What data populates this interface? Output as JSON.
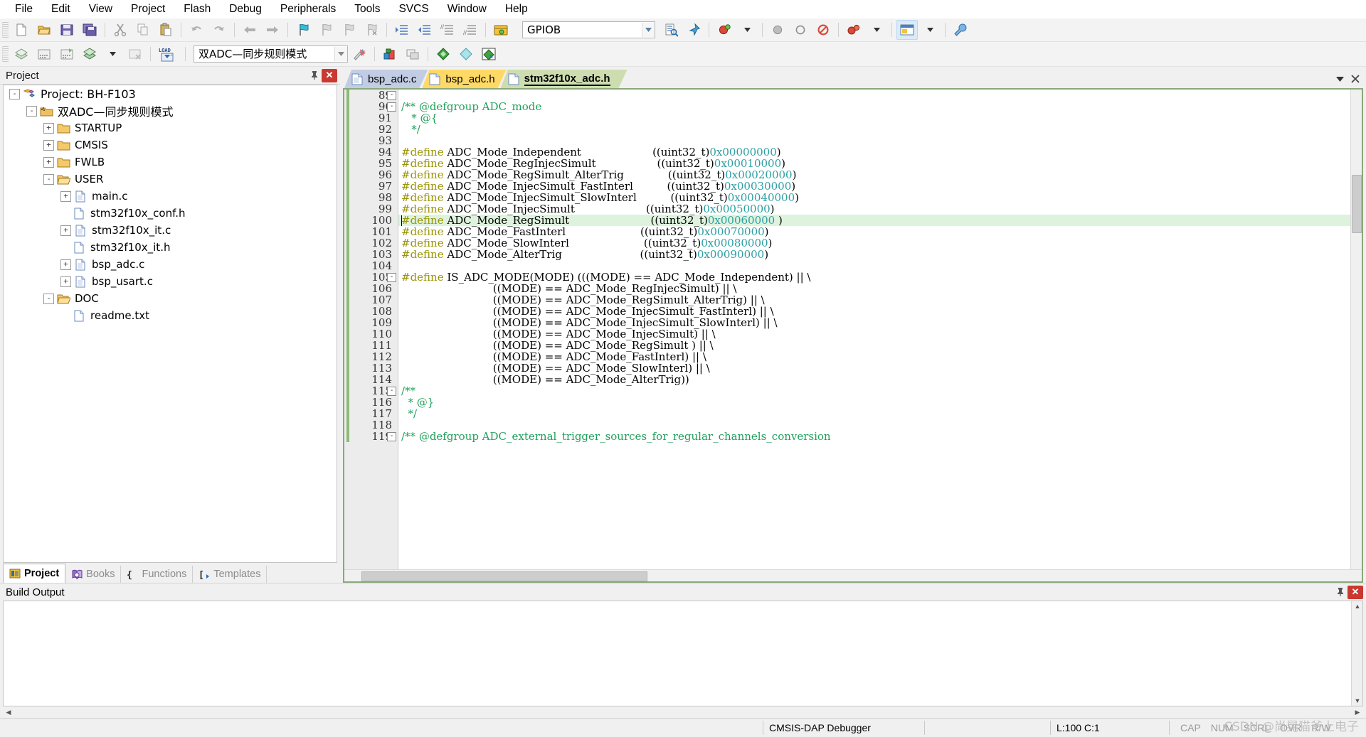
{
  "menu": {
    "items": [
      "File",
      "Edit",
      "View",
      "Project",
      "Flash",
      "Debug",
      "Peripherals",
      "Tools",
      "SVCS",
      "Window",
      "Help"
    ]
  },
  "toolbar1": {
    "icons": [
      "new-file-icon",
      "open-file-icon",
      "save-icon",
      "save-all-icon",
      "cut-icon",
      "copy-icon",
      "paste-icon",
      "undo-icon",
      "redo-icon",
      "navigate-back-icon",
      "navigate-forward-icon",
      "bookmark-toggle-icon",
      "bookmark-prev-icon",
      "bookmark-next-icon",
      "bookmark-clear-icon",
      "indent-icon",
      "outdent-icon",
      "comment-icon",
      "uncomment-icon",
      "open-debugger-icon",
      "find-icon",
      "find-dropdown-icon",
      "breakpoint-insert-icon",
      "breakpoint-disable-icon",
      "breakpoint-disable-all-icon",
      "breakpoint-kill-all-icon",
      "configure-icon",
      "wrench-icon"
    ],
    "find_value": "GPIOB"
  },
  "toolbar2": {
    "icons": [
      "translate-icon",
      "build-icon",
      "rebuild-icon",
      "batch-build-icon",
      "batch-build-dropdown-icon",
      "stop-build-icon",
      "download-icon",
      "target-options-icon",
      "manage-runtime-icon",
      "manage-multi-project-icon",
      "component-green-icon",
      "component-cyan-icon",
      "component-packs-icon"
    ],
    "target_value": "双ADC—同步规则模式"
  },
  "project": {
    "panel_title": "Project",
    "pin_icon": "pin-icon",
    "close_icon": "close-icon",
    "tree": [
      {
        "label": "Project: BH-F103",
        "depth": 0,
        "expander": "-",
        "icon": "project-icon"
      },
      {
        "label": "双ADC—同步规则模式",
        "depth": 1,
        "expander": "-",
        "icon": "target-icon"
      },
      {
        "label": "STARTUP",
        "depth": 2,
        "expander": "+",
        "icon": "folder-icon"
      },
      {
        "label": "CMSIS",
        "depth": 2,
        "expander": "+",
        "icon": "folder-icon"
      },
      {
        "label": "FWLB",
        "depth": 2,
        "expander": "+",
        "icon": "folder-icon"
      },
      {
        "label": "USER",
        "depth": 2,
        "expander": "-",
        "icon": "folder-open-icon"
      },
      {
        "label": "main.c",
        "depth": 3,
        "expander": "+",
        "icon": "c-file-icon"
      },
      {
        "label": "stm32f10x_conf.h",
        "depth": 3,
        "expander": "",
        "icon": "h-file-icon"
      },
      {
        "label": "stm32f10x_it.c",
        "depth": 3,
        "expander": "+",
        "icon": "c-file-icon"
      },
      {
        "label": "stm32f10x_it.h",
        "depth": 3,
        "expander": "",
        "icon": "h-file-icon"
      },
      {
        "label": "bsp_adc.c",
        "depth": 3,
        "expander": "+",
        "icon": "c-file-icon"
      },
      {
        "label": "bsp_usart.c",
        "depth": 3,
        "expander": "+",
        "icon": "c-file-icon"
      },
      {
        "label": "DOC",
        "depth": 2,
        "expander": "-",
        "icon": "folder-open-icon"
      },
      {
        "label": "readme.txt",
        "depth": 3,
        "expander": "",
        "icon": "txt-file-icon"
      }
    ],
    "tabs": [
      {
        "label": "Project",
        "icon": "project-tab-icon",
        "active": true
      },
      {
        "label": "Books",
        "icon": "books-icon",
        "active": false
      },
      {
        "label": "Functions",
        "icon": "functions-icon",
        "active": false
      },
      {
        "label": "Templates",
        "icon": "templates-icon",
        "active": false
      }
    ]
  },
  "editor": {
    "tabs": [
      {
        "label": "bsp_adc.c",
        "color": "#c2cde4",
        "active": false
      },
      {
        "label": "bsp_adc.h",
        "color": "#ffd966",
        "active": false
      },
      {
        "label": "stm32f10x_adc.h",
        "color": "#cdddb0",
        "active": true
      }
    ],
    "dropdown_icon": "chevron-down-icon",
    "close_icon": "close-icon",
    "first_line": 89,
    "current_line": 100,
    "lines": [
      {
        "n": 89,
        "fold": "-",
        "tokens": []
      },
      {
        "n": 90,
        "fold": "-",
        "tokens": [
          {
            "t": "/** @defgroup ADC_mode",
            "c": "cm"
          }
        ]
      },
      {
        "n": 91,
        "fold": "",
        "tokens": [
          {
            "t": "   * @{",
            "c": "cm"
          }
        ]
      },
      {
        "n": 92,
        "fold": "",
        "tokens": [
          {
            "t": "   */",
            "c": "cm"
          }
        ]
      },
      {
        "n": 93,
        "fold": "",
        "tokens": []
      },
      {
        "n": 94,
        "fold": "",
        "tokens": [
          {
            "t": "#define",
            "c": "kw"
          },
          {
            "t": " ADC_Mode_Independent                     ((uint32_t)",
            "c": "pl"
          },
          {
            "t": "0x00000000",
            "c": "num"
          },
          {
            "t": ")",
            "c": "pl"
          }
        ]
      },
      {
        "n": 95,
        "fold": "",
        "tokens": [
          {
            "t": "#define",
            "c": "kw"
          },
          {
            "t": " ADC_Mode_RegInjecSimult                  ((uint32_t)",
            "c": "pl"
          },
          {
            "t": "0x00010000",
            "c": "num"
          },
          {
            "t": ")",
            "c": "pl"
          }
        ]
      },
      {
        "n": 96,
        "fold": "",
        "tokens": [
          {
            "t": "#define",
            "c": "kw"
          },
          {
            "t": " ADC_Mode_RegSimult_AlterTrig             ((uint32_t)",
            "c": "pl"
          },
          {
            "t": "0x00020000",
            "c": "num"
          },
          {
            "t": ")",
            "c": "pl"
          }
        ]
      },
      {
        "n": 97,
        "fold": "",
        "tokens": [
          {
            "t": "#define",
            "c": "kw"
          },
          {
            "t": " ADC_Mode_InjecSimult_FastInterl          ((uint32_t)",
            "c": "pl"
          },
          {
            "t": "0x00030000",
            "c": "num"
          },
          {
            "t": ")",
            "c": "pl"
          }
        ]
      },
      {
        "n": 98,
        "fold": "",
        "tokens": [
          {
            "t": "#define",
            "c": "kw"
          },
          {
            "t": " ADC_Mode_InjecSimult_SlowInterl          ((uint32_t)",
            "c": "pl"
          },
          {
            "t": "0x00040000",
            "c": "num"
          },
          {
            "t": ")",
            "c": "pl"
          }
        ]
      },
      {
        "n": 99,
        "fold": "",
        "tokens": [
          {
            "t": "#define",
            "c": "kw"
          },
          {
            "t": " ADC_Mode_InjecSimult                     ((uint32_t)",
            "c": "pl"
          },
          {
            "t": "0x00050000",
            "c": "num"
          },
          {
            "t": ")",
            "c": "pl"
          }
        ]
      },
      {
        "n": 100,
        "fold": "",
        "hl": true,
        "tokens": [
          {
            "t": "#define",
            "c": "kw"
          },
          {
            "t": " ADC_Mode_RegSimult                        ((uint32_t)",
            "c": "pl"
          },
          {
            "t": "0x00060000",
            "c": "num"
          },
          {
            "t": " )",
            "c": "pl"
          }
        ]
      },
      {
        "n": 101,
        "fold": "",
        "tokens": [
          {
            "t": "#define",
            "c": "kw"
          },
          {
            "t": " ADC_Mode_FastInterl                      ((uint32_t)",
            "c": "pl"
          },
          {
            "t": "0x00070000",
            "c": "num"
          },
          {
            "t": ")",
            "c": "pl"
          }
        ]
      },
      {
        "n": 102,
        "fold": "",
        "tokens": [
          {
            "t": "#define",
            "c": "kw"
          },
          {
            "t": " ADC_Mode_SlowInterl                      ((uint32_t)",
            "c": "pl"
          },
          {
            "t": "0x00080000",
            "c": "num"
          },
          {
            "t": ")",
            "c": "pl"
          }
        ]
      },
      {
        "n": 103,
        "fold": "",
        "tokens": [
          {
            "t": "#define",
            "c": "kw"
          },
          {
            "t": " ADC_Mode_AlterTrig                       ((uint32_t)",
            "c": "pl"
          },
          {
            "t": "0x00090000",
            "c": "num"
          },
          {
            "t": ")",
            "c": "pl"
          }
        ]
      },
      {
        "n": 104,
        "fold": "",
        "tokens": []
      },
      {
        "n": 105,
        "fold": "-",
        "tokens": [
          {
            "t": "#define",
            "c": "kw"
          },
          {
            "t": " IS_ADC_MODE(MODE) (((MODE) == ADC_Mode_Independent) || \\",
            "c": "pl"
          }
        ]
      },
      {
        "n": 106,
        "fold": "",
        "tokens": [
          {
            "t": "                           ((MODE) == ADC_Mode_RegInjecSimult) || \\",
            "c": "pl"
          }
        ]
      },
      {
        "n": 107,
        "fold": "",
        "tokens": [
          {
            "t": "                           ((MODE) == ADC_Mode_RegSimult_AlterTrig) || \\",
            "c": "pl"
          }
        ]
      },
      {
        "n": 108,
        "fold": "",
        "tokens": [
          {
            "t": "                           ((MODE) == ADC_Mode_InjecSimult_FastInterl) || \\",
            "c": "pl"
          }
        ]
      },
      {
        "n": 109,
        "fold": "",
        "tokens": [
          {
            "t": "                           ((MODE) == ADC_Mode_InjecSimult_SlowInterl) || \\",
            "c": "pl"
          }
        ]
      },
      {
        "n": 110,
        "fold": "",
        "tokens": [
          {
            "t": "                           ((MODE) == ADC_Mode_InjecSimult) || \\",
            "c": "pl"
          }
        ]
      },
      {
        "n": 111,
        "fold": "",
        "tokens": [
          {
            "t": "                           ((MODE) == ADC_Mode_RegSimult ) || \\",
            "c": "pl"
          }
        ]
      },
      {
        "n": 112,
        "fold": "",
        "tokens": [
          {
            "t": "                           ((MODE) == ADC_Mode_FastInterl) || \\",
            "c": "pl"
          }
        ]
      },
      {
        "n": 113,
        "fold": "",
        "tokens": [
          {
            "t": "                           ((MODE) == ADC_Mode_SlowInterl) || \\",
            "c": "pl"
          }
        ]
      },
      {
        "n": 114,
        "fold": "",
        "tokens": [
          {
            "t": "                           ((MODE) == ADC_Mode_AlterTrig))",
            "c": "pl"
          }
        ]
      },
      {
        "n": 115,
        "fold": "-",
        "tokens": [
          {
            "t": "/**",
            "c": "cm"
          }
        ]
      },
      {
        "n": 116,
        "fold": "",
        "tokens": [
          {
            "t": "  * @}",
            "c": "cm"
          }
        ]
      },
      {
        "n": 117,
        "fold": "",
        "tokens": [
          {
            "t": "  */",
            "c": "cm"
          }
        ]
      },
      {
        "n": 118,
        "fold": "",
        "tokens": []
      },
      {
        "n": 119,
        "fold": "-",
        "tokens": [
          {
            "t": "/** @defgroup ADC_external_trigger_sources_for_regular_channels_conversion",
            "c": "cm"
          }
        ]
      }
    ]
  },
  "build_output": {
    "panel_title": "Build Output",
    "pin_icon": "pin-icon",
    "close_icon": "close-icon",
    "text": ""
  },
  "status": {
    "message": "",
    "debugger": "CMSIS-DAP Debugger",
    "position": "L:100 C:1",
    "flags": [
      "CAP",
      "NUM",
      "SCRL",
      "OVR",
      "R/W"
    ]
  },
  "watermark": "CSDN @尚晃猫爷上电子",
  "colors": {
    "comment": "#1f9f5a",
    "keyword": "#9a9405",
    "number": "#2c9ea3",
    "current_line": "#ddf3dd",
    "modified_bar": "#8fba76",
    "tab_active": "#cdddb0"
  }
}
